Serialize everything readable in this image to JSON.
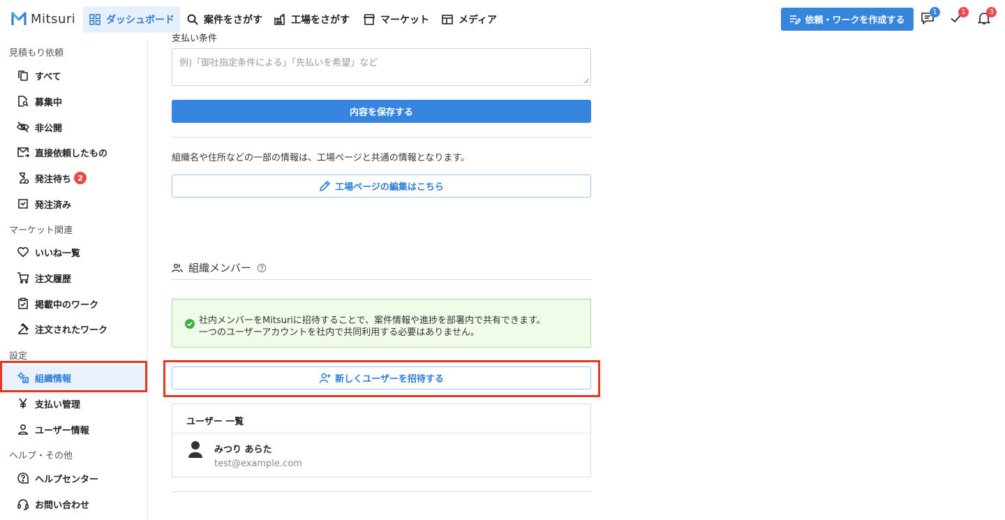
{
  "app": {
    "logo_text": "Mitsuri"
  },
  "topnav": {
    "items": [
      {
        "label": "ダッシュボード",
        "icon": "grid-icon"
      },
      {
        "label": "案件をさがす",
        "icon": "search-icon"
      },
      {
        "label": "工場をさがす",
        "icon": "factory-icon"
      },
      {
        "label": "マーケット",
        "icon": "store-icon"
      },
      {
        "label": "メディア",
        "icon": "newspaper-icon"
      }
    ],
    "create_label": "依頼・ワークを作成する",
    "messages_count": "1",
    "tasks_count": "1",
    "notifications_count": "3"
  },
  "sidebar": {
    "sections": [
      {
        "title": "見積もり依頼",
        "items": [
          {
            "label": "すべて",
            "icon": "copy-icon"
          },
          {
            "label": "募集中",
            "icon": "document-search-icon"
          },
          {
            "label": "非公開",
            "icon": "eye-off-icon"
          },
          {
            "label": "直接依頼したもの",
            "icon": "mail-icon"
          },
          {
            "label": "発注待ち",
            "icon": "hourglass-icon",
            "count": "2"
          },
          {
            "label": "発注済み",
            "icon": "box-icon"
          }
        ]
      },
      {
        "title": "マーケット関連",
        "items": [
          {
            "label": "いいね一覧",
            "icon": "heart-icon"
          },
          {
            "label": "注文履歴",
            "icon": "cart-icon"
          },
          {
            "label": "掲載中のワーク",
            "icon": "clipboard-icon"
          },
          {
            "label": "注文されたワーク",
            "icon": "tools-icon"
          }
        ]
      },
      {
        "title": "設定",
        "items": [
          {
            "label": "組織情報",
            "icon": "organization-settings-icon"
          },
          {
            "label": "支払い管理",
            "icon": "yen-icon"
          },
          {
            "label": "ユーザー情報",
            "icon": "user-icon"
          }
        ]
      },
      {
        "title": "ヘルプ・その他",
        "items": [
          {
            "label": "ヘルプセンター",
            "icon": "help-icon"
          },
          {
            "label": "お問い合わせ",
            "icon": "headset-icon"
          }
        ]
      }
    ]
  },
  "form": {
    "cut_label": "支払い条件",
    "payment_placeholder": "例)「御社指定条件による」「先払いを希望」など",
    "save_label": "内容を保存する",
    "shared_info_text": "組織名や住所などの一部の情報は、工場ページと共通の情報となります。",
    "edit_factory_label": "工場ページの編集はこちら"
  },
  "members": {
    "title": "組織メンバー",
    "alert_line1": "社内メンバーをMitsuriに招待することで、案件情報や進捗を部署内で共有できます。",
    "alert_line2": "一つのユーザーアカウントを社内で共同利用する必要はありません。",
    "invite_label": "新しくユーザーを招待する",
    "list_header": "ユーザー 一覧",
    "users": [
      {
        "name": "みつり あらた",
        "email": "test@example.com"
      }
    ]
  },
  "colors": {
    "accent": "#3584de",
    "highlight": "#e8351c",
    "success_bg": "#f1fbea",
    "badge_red": "#e94b4b"
  }
}
